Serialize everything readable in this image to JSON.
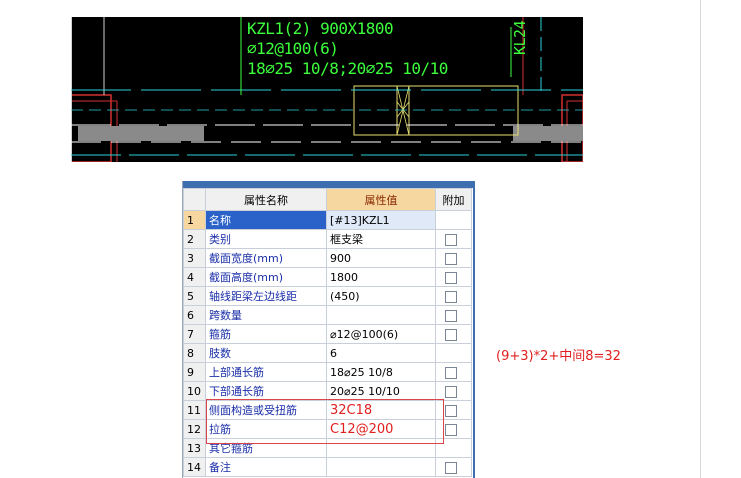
{
  "cad": {
    "lines": [
      "KZL1(2) 900X1800",
      "⌀12@100(6)",
      "18⌀25 10/8;20⌀25 10/10"
    ],
    "side_label": "KL24"
  },
  "grid": {
    "headers": [
      "属性名称",
      "属性值",
      "附加"
    ],
    "rows": [
      {
        "no": "1",
        "name": "名称",
        "value": "[#13]KZL1",
        "checkbox": false,
        "selected": true
      },
      {
        "no": "2",
        "name": "类别",
        "value": "框支梁",
        "checkbox": true
      },
      {
        "no": "3",
        "name": "截面宽度(mm)",
        "value": "900",
        "checkbox": true
      },
      {
        "no": "4",
        "name": "截面高度(mm)",
        "value": "1800",
        "checkbox": true
      },
      {
        "no": "5",
        "name": "轴线距梁左边线距",
        "value": "(450)",
        "checkbox": true
      },
      {
        "no": "6",
        "name": "跨数量",
        "value": "",
        "checkbox": true
      },
      {
        "no": "7",
        "name": "箍筋",
        "value": "⌀12@100(6)",
        "checkbox": true
      },
      {
        "no": "8",
        "name": "肢数",
        "value": "6",
        "checkbox": false
      },
      {
        "no": "9",
        "name": "上部通长筋",
        "value": "18⌀25 10/8",
        "checkbox": true
      },
      {
        "no": "10",
        "name": "下部通长筋",
        "value": "20⌀25 10/10",
        "checkbox": true
      },
      {
        "no": "11",
        "name": "侧面构造或受扭筋",
        "value": "32C18",
        "checkbox": true,
        "red": true
      },
      {
        "no": "12",
        "name": "拉筋",
        "value": "C12@200",
        "checkbox": true,
        "red": true
      },
      {
        "no": "13",
        "name": "其它箍筋",
        "value": "",
        "checkbox": false
      },
      {
        "no": "14",
        "name": "备注",
        "value": "",
        "checkbox": true
      }
    ]
  },
  "annotation": "(9+3)*2+中间8=32",
  "colors": {
    "cad_text": "#3cff3c",
    "selected_row": "#2a62c9",
    "header_value": "#f6d7a0",
    "annotation": "#e02020"
  }
}
